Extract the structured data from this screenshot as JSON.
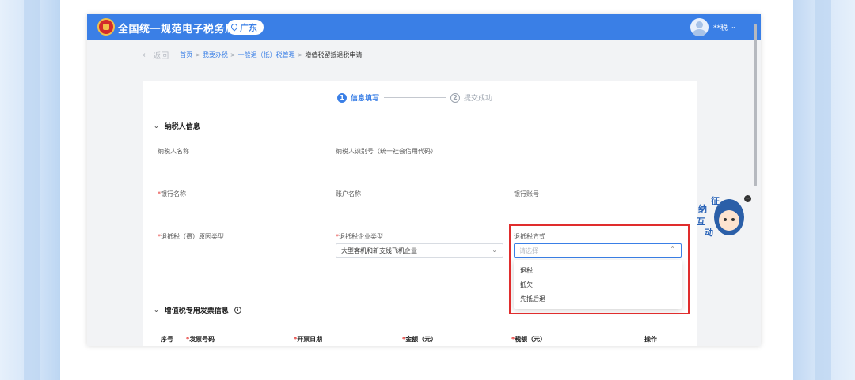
{
  "header": {
    "app_title": "全国统一规范电子税务局",
    "region": "广东",
    "username": "**税"
  },
  "breadcrumb": {
    "back_label": "返回",
    "items": [
      "首页",
      "我要办税",
      "一般退（抵）税管理"
    ],
    "separator": ">",
    "current": "增值税留抵退税申请"
  },
  "steps": [
    {
      "number": "1",
      "label": "信息填写",
      "active": true
    },
    {
      "number": "2",
      "label": "提交成功",
      "active": false
    }
  ],
  "taxpayer_section": {
    "title": "纳税人信息",
    "fields": {
      "name_label": "纳税人名称",
      "id_label": "纳税人识别号（统一社会信用代码）",
      "bank_name_label": "银行名称",
      "account_name_label": "账户名称",
      "bank_account_label": "银行账号",
      "reason_label": "退抵税（费）原因类型",
      "enterprise_type_label": "退抵税企业类型",
      "enterprise_type_value": "大型客机和新支线飞机企业",
      "method_label": "退抵税方式",
      "method_placeholder": "请选择"
    },
    "required_mark": "*",
    "method_options": [
      "退税",
      "抵欠",
      "先抵后退"
    ]
  },
  "invoice_section": {
    "title": "增值税专用发票信息",
    "columns": [
      "序号",
      "发票号码",
      "开票日期",
      "金额（元）",
      "税额（元）",
      "操作"
    ]
  },
  "mascot": {
    "chars": [
      "征",
      "纳",
      "互",
      "动"
    ]
  },
  "colors": {
    "primary": "#3a7fe6",
    "highlight": "#e02d2d",
    "required": "#e53935"
  }
}
